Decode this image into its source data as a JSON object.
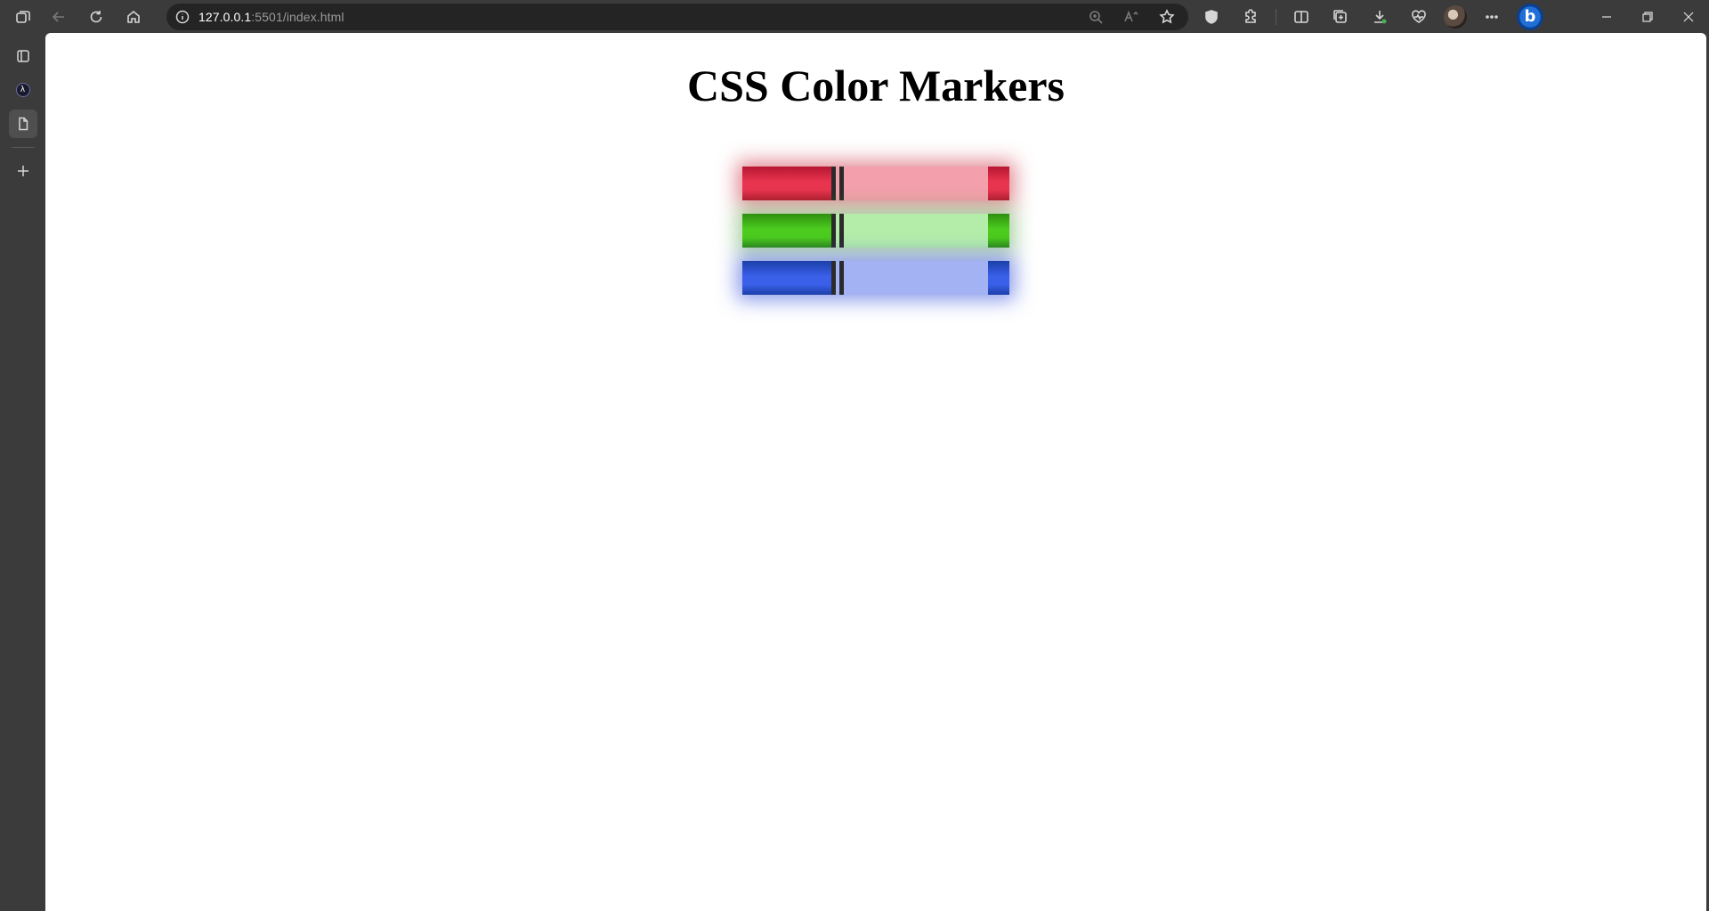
{
  "browser": {
    "url_host": "127.0.0.1",
    "url_rest": ":5501/index.html"
  },
  "page": {
    "title": "CSS Color Markers"
  },
  "markers": [
    {
      "name": "red",
      "dark": "#b71732",
      "mid": "#e8344f",
      "light": "#f3a0ac",
      "glow": "rgba(200,40,60,0.55)"
    },
    {
      "name": "green",
      "dark": "#2e8f0f",
      "mid": "#4ccc1e",
      "light": "#b4ecaa",
      "glow": "rgba(60,150,40,0.45)"
    },
    {
      "name": "blue",
      "dark": "#1b3fa8",
      "mid": "#3a5fe8",
      "light": "#a2b2f2",
      "glow": "rgba(40,70,220,0.55)"
    }
  ]
}
